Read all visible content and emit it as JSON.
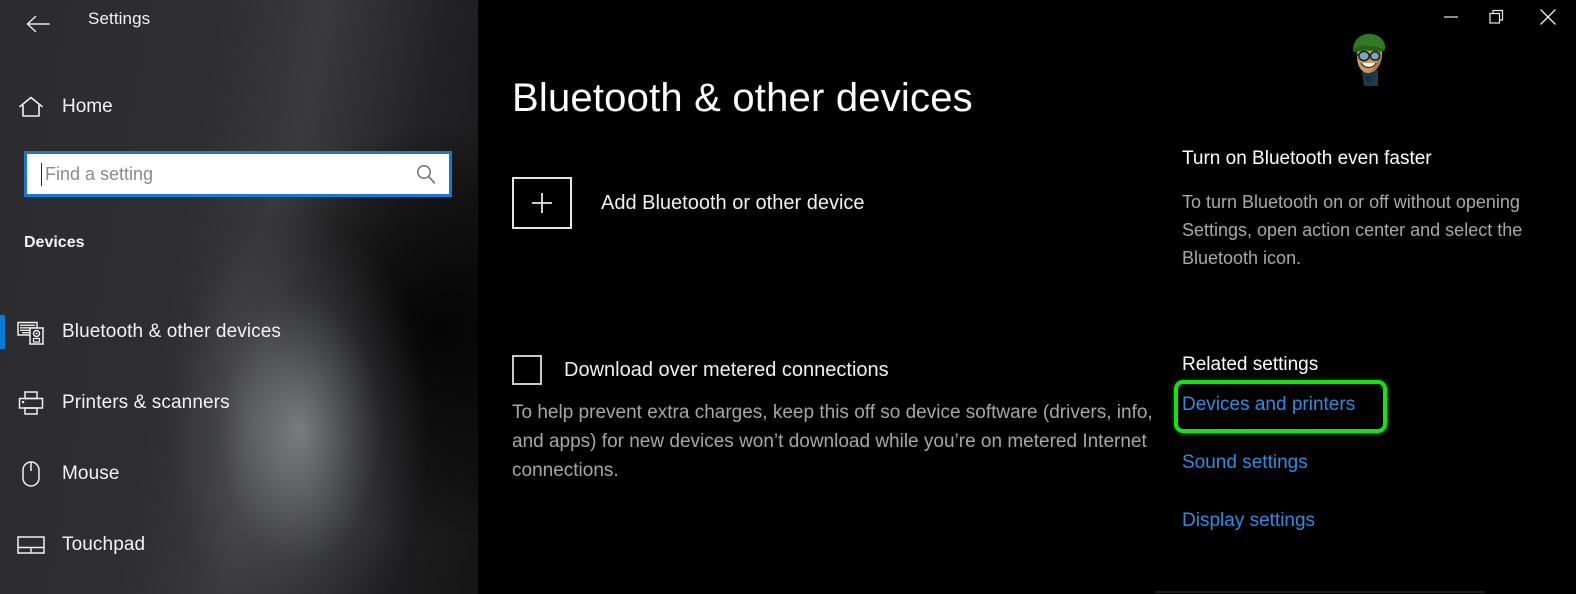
{
  "window": {
    "title": "Settings",
    "back_icon": "back-arrow-icon",
    "controls": [
      {
        "name": "minimize-button",
        "icon": "minimize-icon"
      },
      {
        "name": "restore-button",
        "icon": "restore-icon"
      },
      {
        "name": "close-button",
        "icon": "close-icon"
      }
    ],
    "avatar_icon": "user-avatar-icon"
  },
  "sidebar": {
    "home": {
      "label": "Home",
      "icon": "home-icon"
    },
    "search": {
      "value": "",
      "placeholder": "Find a setting",
      "icon": "search-icon"
    },
    "group_header": "Devices",
    "items": [
      {
        "label": "Bluetooth & other devices",
        "icon": "bluetooth-devices-icon",
        "selected": true
      },
      {
        "label": "Printers & scanners",
        "icon": "printer-icon",
        "selected": false
      },
      {
        "label": "Mouse",
        "icon": "mouse-icon",
        "selected": false
      },
      {
        "label": "Touchpad",
        "icon": "touchpad-icon",
        "selected": false
      }
    ]
  },
  "main": {
    "page_title": "Bluetooth & other devices",
    "add_device": {
      "label": "Add Bluetooth or other device",
      "icon": "plus-icon"
    },
    "metered": {
      "label": "Download over metered connections",
      "checked": false,
      "description": "To help prevent extra charges, keep this off so device software (drivers, info, and apps) for new devices won’t download while you’re on metered Internet connections."
    }
  },
  "right_panel": {
    "tip_title": "Turn on Bluetooth even faster",
    "tip_body": "To turn Bluetooth on or off without opening Settings, open action center and select the Bluetooth icon.",
    "related_title": "Related settings",
    "related_links": [
      "Devices and printers",
      "Sound settings",
      "Display settings"
    ],
    "highlighted_link_index": 0
  },
  "colors": {
    "accent_blue": "#0a7ad4",
    "link_blue": "#2e8ce0",
    "highlight_green": "#11e511",
    "search_border": "#1878d4",
    "sidebar_bg": "#2b2b2b",
    "main_bg": "#000000"
  }
}
